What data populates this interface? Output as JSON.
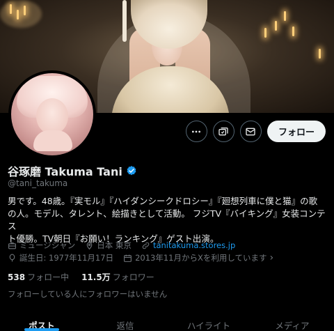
{
  "profile": {
    "display_name": "谷琢磨 Takuma Tani",
    "handle": "@tani_takuma",
    "verified_icon": "verified-badge-icon",
    "accent_color": "#1d9bf0"
  },
  "actions": {
    "more_icon": "more-icon",
    "subscribe_icon": "subscribe-icon",
    "message_icon": "message-icon",
    "follow_label": "フォロー"
  },
  "bio": {
    "line1": "男です。48歳。『実モル』『ハイダンシークドロシー』『廻想列車に僕と猫』の歌",
    "line2": "の人。モデル、タレント、絵描きとして活動。 フジTV『バイキング』女装コンテス",
    "line3": "ト優勝。TV朝日『お願い！ランキング』ゲスト出演。"
  },
  "meta": {
    "category": "ミュージシャン",
    "location": "日本 東京",
    "website": "tanitakuma.stores.jp",
    "birthday": "誕生日: 1977年11月17日",
    "joined": "2013年11月からXを利用しています",
    "joined_chevron": "›"
  },
  "stats": {
    "following_count": "538",
    "following_label": "フォロー中",
    "followers_count": "11.5万",
    "followers_label": "フォロワー"
  },
  "followers_note": "フォローしている人にフォロワーはいません",
  "tabs": [
    {
      "label": "ポスト",
      "active": true
    },
    {
      "label": "返信",
      "active": false
    },
    {
      "label": "ハイライト",
      "active": false
    },
    {
      "label": "メディア",
      "active": false
    }
  ]
}
